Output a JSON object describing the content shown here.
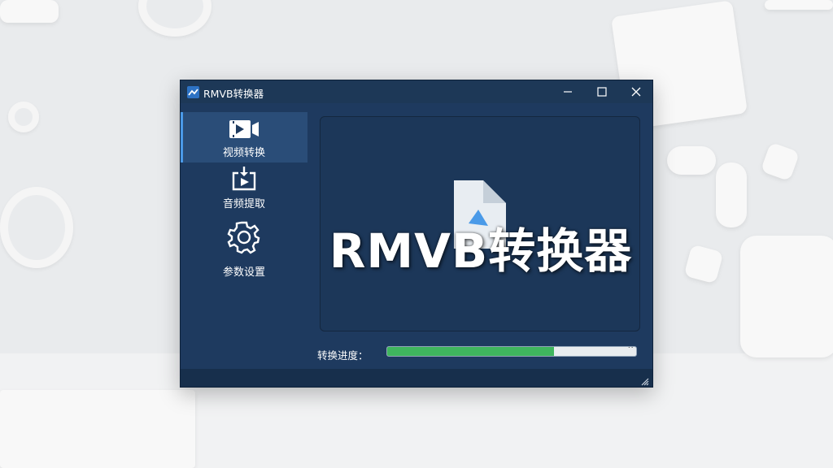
{
  "window": {
    "title": "RMVB转换器",
    "controls": [
      "minimize-icon",
      "maximize-icon",
      "close-icon"
    ]
  },
  "sidebar": {
    "items": [
      {
        "label": "视频转换",
        "icon": "video-convert-icon",
        "active": true
      },
      {
        "label": "音频提取",
        "icon": "audio-extract-icon",
        "active": false
      },
      {
        "label": "参数设置",
        "icon": "gear-icon",
        "active": false
      }
    ]
  },
  "main": {
    "overlay_title": "RMVB转换器",
    "file_icon": "document-icon",
    "progress_label": "转换进度：",
    "progress": 0.67,
    "progress_end_mark": "^"
  },
  "colors": {
    "window_bg": "#1e3a5f",
    "active_item": "#2a4d78",
    "progress_fill": "#3fb55e",
    "accent": "#4a9ae8"
  }
}
